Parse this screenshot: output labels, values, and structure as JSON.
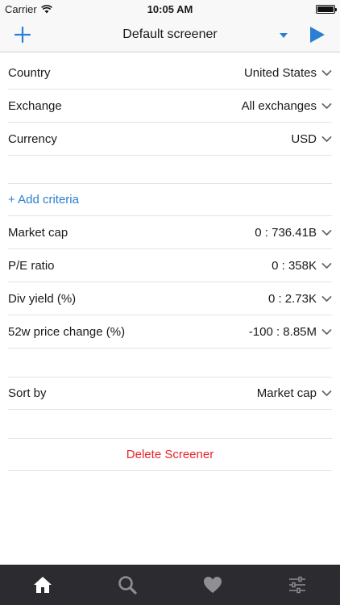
{
  "status_bar": {
    "carrier": "Carrier",
    "time": "10:05 AM",
    "battery_level": 1.0
  },
  "nav": {
    "title": "Default screener",
    "add_icon": "plus-icon",
    "caret_icon": "caret-down-icon",
    "run_icon": "play-icon",
    "accent": "#2a7fd2"
  },
  "filters": [
    {
      "label": "Country",
      "value": "United States"
    },
    {
      "label": "Exchange",
      "value": "All exchanges"
    },
    {
      "label": "Currency",
      "value": "USD"
    }
  ],
  "add_criteria": "+ Add criteria",
  "criteria": [
    {
      "label": "Market cap",
      "value": "0 : 736.41B"
    },
    {
      "label": "P/E ratio",
      "value": "0 : 358K"
    },
    {
      "label": "Div yield (%)",
      "value": "0 : 2.73K"
    },
    {
      "label": "52w price change (%)",
      "value": "-100 : 8.85M"
    }
  ],
  "sort": {
    "label": "Sort by",
    "value": "Market cap"
  },
  "delete_label": "Delete Screener",
  "delete_color": "#e8242b",
  "tabs": [
    {
      "icon": "home-icon",
      "active": true
    },
    {
      "icon": "search-icon",
      "active": false
    },
    {
      "icon": "heart-icon",
      "active": false
    },
    {
      "icon": "sliders-icon",
      "active": false
    }
  ]
}
